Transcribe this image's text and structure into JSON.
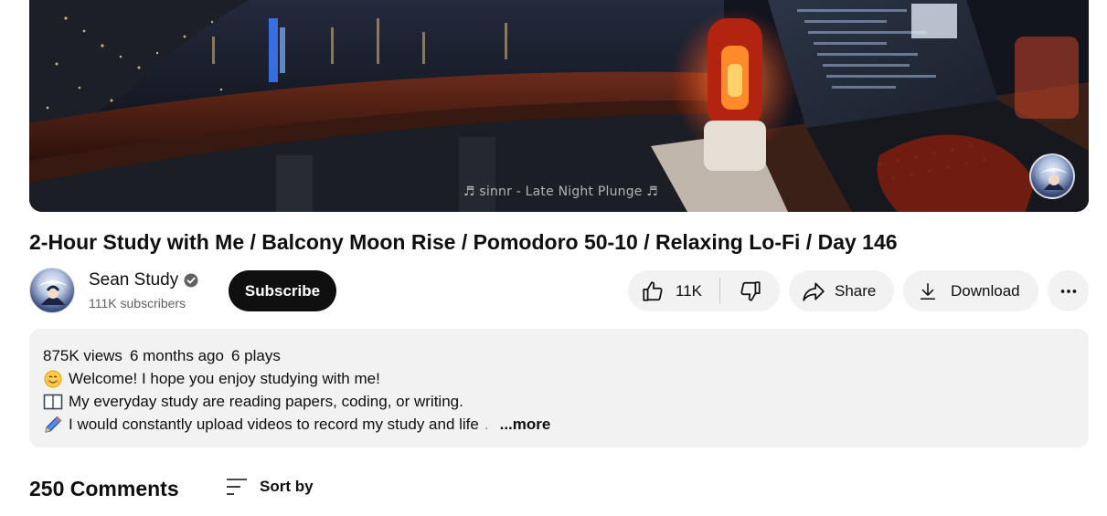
{
  "player": {
    "now_playing": "♬ sinnr - Late Night Plunge ♬"
  },
  "video": {
    "title": "2-Hour Study with Me / Balcony Moon Rise / Pomodoro 50-10 / Relaxing Lo-Fi / Day 146"
  },
  "owner": {
    "channel_name": "Sean Study",
    "subscribers": "111K subscribers",
    "subscribe_label": "Subscribe"
  },
  "actions": {
    "like_count": "11K",
    "share_label": "Share",
    "download_label": "Download"
  },
  "description": {
    "views": "875K views",
    "date": "6 months ago",
    "plays": "6 plays",
    "lines": [
      {
        "icon": "smiling-face-icon",
        "text": "Welcome! I hope you enjoy studying with me!"
      },
      {
        "icon": "open-book-icon",
        "text": "My everyday study are reading papers, coding, or writing."
      },
      {
        "icon": "pen-icon",
        "text": "I would constantly upload videos to record my study and life",
        "faded_tail": "."
      }
    ],
    "more_label": "...more"
  },
  "comments": {
    "count_label": "250 Comments",
    "sort_label": "Sort by"
  },
  "colors": {
    "subscribe_bg": "#0f0f0f",
    "pill_bg": "#f2f2f2",
    "secondary_text": "#606060"
  }
}
